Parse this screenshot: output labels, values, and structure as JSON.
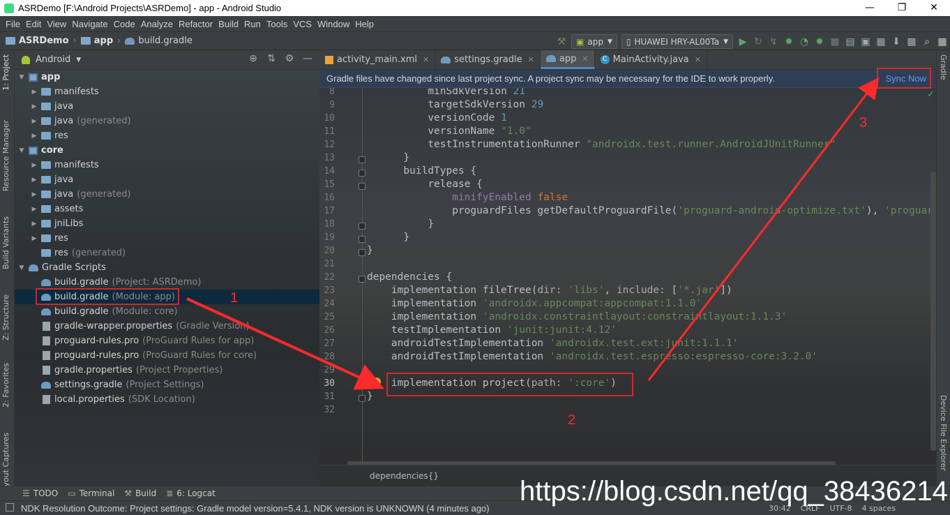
{
  "window": {
    "title": "ASRDemo [F:\\Android Projects\\ASRDemo] - app - Android Studio",
    "minimize": "—",
    "maximize": "❐",
    "close": "✕"
  },
  "menu": [
    "File",
    "Edit",
    "View",
    "Navigate",
    "Code",
    "Analyze",
    "Refactor",
    "Build",
    "Run",
    "Tools",
    "VCS",
    "Window",
    "Help"
  ],
  "nav": {
    "crumbs": [
      "ASRDemo",
      "app",
      "build.gradle"
    ],
    "run_config": "app",
    "device": "HUAWEI HRY-AL00Ta"
  },
  "left_tool_tabs": [
    "1: Project",
    "Resource Manager",
    "Build Variants",
    "Z: Structure",
    "2: Favorites",
    "Layout Captures"
  ],
  "right_tool_tabs": [
    "Gradle",
    "Device File Explorer"
  ],
  "project": {
    "view": "Android",
    "tree": [
      {
        "label": "app",
        "hint": "",
        "bold": true
      },
      {
        "label": "manifests",
        "hint": ""
      },
      {
        "label": "java",
        "hint": ""
      },
      {
        "label": "java",
        "hint": "(generated)"
      },
      {
        "label": "res",
        "hint": ""
      },
      {
        "label": "core",
        "hint": "",
        "bold": true
      },
      {
        "label": "manifests",
        "hint": ""
      },
      {
        "label": "java",
        "hint": ""
      },
      {
        "label": "java",
        "hint": "(generated)"
      },
      {
        "label": "assets",
        "hint": ""
      },
      {
        "label": "jniLibs",
        "hint": ""
      },
      {
        "label": "res",
        "hint": ""
      },
      {
        "label": "res",
        "hint": "(generated)"
      },
      {
        "label": "Gradle Scripts",
        "hint": ""
      },
      {
        "label": "build.gradle",
        "hint": "(Project: ASRDemo)"
      },
      {
        "label": "build.gradle",
        "hint": "(Module: app)"
      },
      {
        "label": "build.gradle",
        "hint": "(Module: core)"
      },
      {
        "label": "gradle-wrapper.properties",
        "hint": "(Gradle Version)"
      },
      {
        "label": "proguard-rules.pro",
        "hint": "(ProGuard Rules for app)"
      },
      {
        "label": "proguard-rules.pro",
        "hint": "(ProGuard Rules for core)"
      },
      {
        "label": "gradle.properties",
        "hint": "(Project Properties)"
      },
      {
        "label": "settings.gradle",
        "hint": "(Project Settings)"
      },
      {
        "label": "local.properties",
        "hint": "(SDK Location)"
      }
    ]
  },
  "tabs": [
    {
      "label": "activity_main.xml"
    },
    {
      "label": "settings.gradle"
    },
    {
      "label": "app"
    },
    {
      "label": "MainActivity.java"
    }
  ],
  "sync_banner": {
    "message": "Gradle files have changed since last project sync. A project sync may be necessary for the IDE to work properly.",
    "action": "Sync Now"
  },
  "code": {
    "line_numbers": [
      "8",
      "9",
      "10",
      "11",
      "12",
      "13",
      "14",
      "15",
      "16",
      "17",
      "18",
      "19",
      "20",
      "21",
      "22",
      "23",
      "24",
      "25",
      "26",
      "27",
      "28",
      "29",
      "30",
      "31",
      "32"
    ],
    "l8": "minSdkVersion",
    "l8v": "21",
    "l9": "targetSdkVersion",
    "l9v": "29",
    "l10": "versionCode",
    "l10v": "1",
    "l11": "versionName",
    "l11v": "\"1.0\"",
    "l12": "testInstrumentationRunner",
    "l12v": "\"androidx.test.runner.AndroidJUnitRunner\"",
    "l13": "}",
    "l14": "buildTypes {",
    "l15": "release {",
    "l16a": "minifyEnabled",
    "l16b": "false",
    "l17a": "proguardFiles getDefaultProguardFile(",
    "l17b": "'proguard-android-optimize.txt'",
    "l17c": "), ",
    "l17d": "'proguar",
    "l18": "}",
    "l19": "}",
    "l20": "}",
    "l22": "dependencies {",
    "l23a": "implementation fileTree(",
    "l23b": "dir:",
    "l23c": "'libs'",
    "l23d": ", ",
    "l23e": "include:",
    "l23f": " [",
    "l23g": "'*.jar'",
    "l23h": "])",
    "l24a": "implementation ",
    "l24b": "'androidx.appcompat:appcompat:1.1.0'",
    "l25a": "implementation ",
    "l25b": "'androidx.constraintlayout:constraintlayout:1.1.3'",
    "l26a": "testImplementation ",
    "l26b": "'junit:junit:4.12'",
    "l27a": "androidTestImplementation ",
    "l27b": "'androidx.test.ext:junit:1.1.1'",
    "l28a": "androidTestImplementation ",
    "l28b": "'androidx.test.espresso:espresso-core:3.2.0'",
    "l30a": "implementation project(",
    "l30b": "path:",
    "l30c": " ",
    "l30d": "':core'",
    "l30e": ")",
    "l31": "}"
  },
  "breadcrumb": "dependencies{}",
  "bottom_tabs": [
    "TODO",
    "Terminal",
    "Build",
    "6: Logcat"
  ],
  "status": {
    "message": "NDK Resolution Outcome: Project settings: Gradle model version=5.4.1, NDK version is UNKNOWN (4 minutes ago)",
    "position": "30:42",
    "line_sep": "CRLF",
    "encoding": "UTF-8",
    "indent": "4 spaces"
  },
  "annotations": {
    "n1": "1",
    "n2": "2",
    "n3": "3",
    "color": "#ff2a2a"
  },
  "watermark": "https://blog.csdn.net/qq_38436214"
}
